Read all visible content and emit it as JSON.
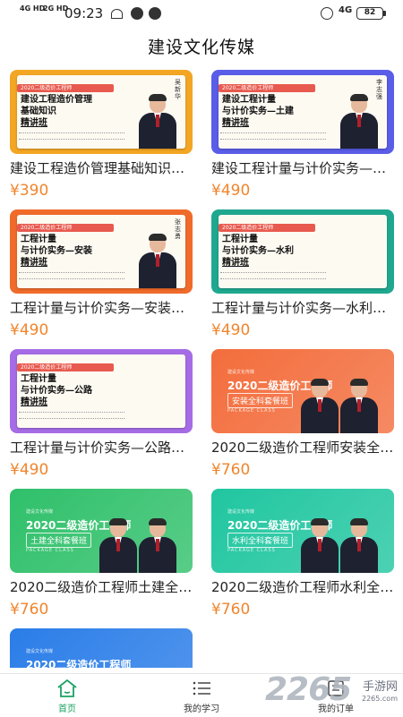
{
  "status_bar": {
    "signal_1": "4G HD",
    "signal_2": "2G HD",
    "time": "09:23",
    "network": "4G",
    "battery": "82"
  },
  "header": {
    "title": "建设文化传媒"
  },
  "colors": {
    "price": "#f0852d",
    "active_tab": "#1aa260"
  },
  "courses": [
    {
      "name": "建设工程造价管理基础知识精讲班",
      "price": "¥390",
      "thumb": {
        "theme": "#f2a623",
        "ribbon": "2020二级造价工程师",
        "line1": "建设工程造价管理",
        "line2": "基础知识",
        "line3": "精讲班",
        "teacher": "吴新华"
      }
    },
    {
      "name": "建设工程计量与计价实务—土建精讲班",
      "price": "¥490",
      "thumb": {
        "theme": "#5a5de8",
        "ribbon": "2020二级造价工程师",
        "line1": "建设工程计量",
        "line2": "与计价实务—土建",
        "line3": "精讲班",
        "teacher": "李志强"
      }
    },
    {
      "name": "工程计量与计价实务—安装精讲班",
      "price": "¥490",
      "thumb": {
        "theme": "#f06b2a",
        "ribbon": "2020二级造价工程师",
        "line1": "工程计量",
        "line2": "与计价实务—安装",
        "line3": "精讲班",
        "teacher": "张志勇"
      }
    },
    {
      "name": "工程计量与计价实务—水利精讲班",
      "price": "¥490",
      "thumb": {
        "theme": "#1fa88f",
        "ribbon": "2020二级造价工程师",
        "line1": "工程计量",
        "line2": "与计价实务—水利",
        "line3": "精讲班",
        "teacher": ""
      }
    },
    {
      "name": "工程计量与计价实务—公路精讲班",
      "price": "¥490",
      "thumb": {
        "theme": "#a56ce6",
        "ribbon": "2020二级造价工程师",
        "line1": "工程计量",
        "line2": "与计价实务—公路",
        "line3": "精讲班",
        "teacher": ""
      }
    },
    {
      "name": "2020二级造价工程师安装全科套餐班",
      "price": "¥760",
      "pkg": {
        "theme": "#f36d3c",
        "tag": "建设文化传媒",
        "line1": "2020二级造价工程师",
        "line2": "安装全科套餐班",
        "line3": "PACKAGE CLASS"
      }
    },
    {
      "name": "2020二级造价工程师土建全科套餐班",
      "price": "¥760",
      "pkg": {
        "theme": "#2fc06a",
        "tag": "建设文化传媒",
        "line1": "2020二级造价工程师",
        "line2": "土建全科套餐班",
        "line3": "PACKAGE CLASS"
      }
    },
    {
      "name": "2020二级造价工程师水利全科套餐班",
      "price": "¥760",
      "pkg": {
        "theme": "#20c6a0",
        "tag": "建设文化传媒",
        "line1": "2020二级造价工程师",
        "line2": "水利全科套餐班",
        "line3": "PACKAGE CLASS"
      }
    },
    {
      "name": "2020二级造价工程师",
      "price": "",
      "pkg": {
        "theme": "#2a7de8",
        "tag": "建设文化传媒",
        "line1": "2020二级造价工程师",
        "line2": "",
        "line3": ""
      }
    }
  ],
  "tabs": [
    {
      "label": "首页",
      "icon": "home-icon",
      "active": true
    },
    {
      "label": "我的学习",
      "icon": "list-icon",
      "active": false
    },
    {
      "label": "我的订单",
      "icon": "order-icon",
      "active": false
    }
  ],
  "watermark": {
    "brand": "2265",
    "site_name": "手游网",
    "url": "2265.com"
  }
}
